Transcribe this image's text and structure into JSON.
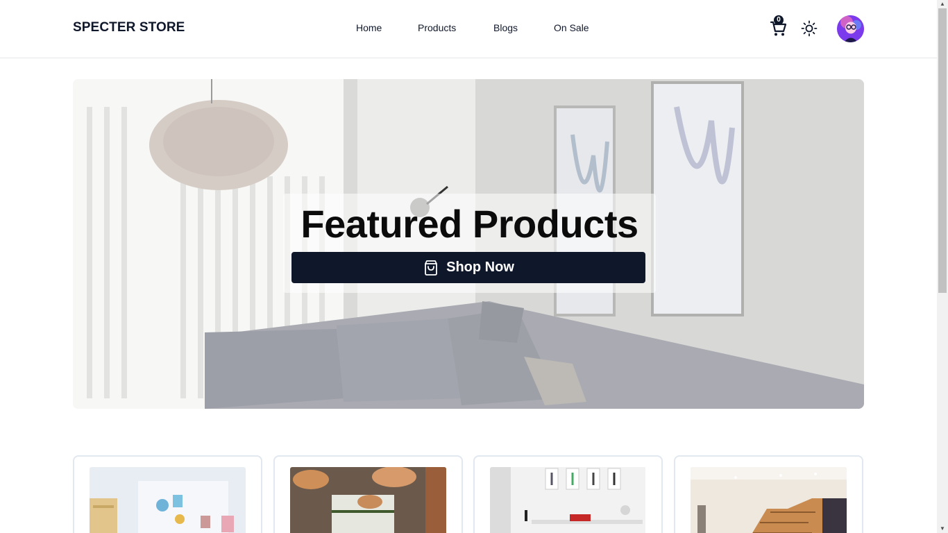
{
  "navbar": {
    "brand": "SPECTER STORE",
    "links": [
      {
        "label": "Home"
      },
      {
        "label": "Products"
      },
      {
        "label": "Blogs"
      },
      {
        "label": "On Sale"
      }
    ],
    "cart_count": "0",
    "icons": {
      "cart": "cart-icon",
      "theme": "sun-icon",
      "avatar": "avatar"
    }
  },
  "hero": {
    "title": "Featured Products",
    "button_label": "Shop Now",
    "button_icon": "shopping-bag-icon"
  },
  "colors": {
    "primary": "#0f172a",
    "border": "#e2e8f0",
    "background": "#ffffff"
  }
}
